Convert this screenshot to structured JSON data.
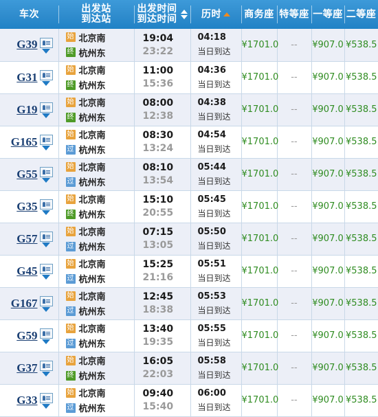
{
  "header": {
    "code_label": "车次",
    "station_label_top": "出发站",
    "station_label_bottom": "到达站",
    "time_label_top": "出发时间",
    "time_label_bottom": "到达时间",
    "duration_label": "历时",
    "business_label": "商务座",
    "premium_label": "特等座",
    "first_label": "一等座",
    "second_label": "二等座",
    "sort_active_column": "历时",
    "sort_direction": "asc",
    "bg_color": "#2f8ccd",
    "active_sort_color": "#f08a1e"
  },
  "legend": {
    "start_marker": "始",
    "end_marker": "终",
    "pass_marker": "过",
    "start_color": "#e8a33d",
    "end_color": "#4f9b28",
    "pass_color": "#5b9bd5"
  },
  "icons": {
    "detail_icon": "train-detail-icon",
    "expand_icon": "chevron-down-icon",
    "sort_up_icon": "sort-ascending-icon",
    "sort_down_icon": "sort-descending-icon"
  },
  "rows": [
    {
      "code": "G39",
      "from_marker": "始",
      "from_type": "start",
      "from_station": "北京南",
      "to_marker": "终",
      "to_type": "end",
      "to_station": "杭州东",
      "depart": "19:04",
      "arrive": "23:22",
      "duration": "04:18",
      "arrive_note": "当日到达",
      "business": "¥1701.0",
      "premium": "--",
      "first": "¥907.0",
      "second": "¥538.5"
    },
    {
      "code": "G31",
      "from_marker": "始",
      "from_type": "start",
      "from_station": "北京南",
      "to_marker": "终",
      "to_type": "end",
      "to_station": "杭州东",
      "depart": "11:00",
      "arrive": "15:36",
      "duration": "04:36",
      "arrive_note": "当日到达",
      "business": "¥1701.0",
      "premium": "--",
      "first": "¥907.0",
      "second": "¥538.5"
    },
    {
      "code": "G19",
      "from_marker": "始",
      "from_type": "start",
      "from_station": "北京南",
      "to_marker": "终",
      "to_type": "end",
      "to_station": "杭州东",
      "depart": "08:00",
      "arrive": "12:38",
      "duration": "04:38",
      "arrive_note": "当日到达",
      "business": "¥1701.0",
      "premium": "--",
      "first": "¥907.0",
      "second": "¥538.5"
    },
    {
      "code": "G165",
      "from_marker": "始",
      "from_type": "start",
      "from_station": "北京南",
      "to_marker": "过",
      "to_type": "pass",
      "to_station": "杭州东",
      "depart": "08:30",
      "arrive": "13:24",
      "duration": "04:54",
      "arrive_note": "当日到达",
      "business": "¥1701.0",
      "premium": "--",
      "first": "¥907.0",
      "second": "¥538.5"
    },
    {
      "code": "G55",
      "from_marker": "始",
      "from_type": "start",
      "from_station": "北京南",
      "to_marker": "过",
      "to_type": "pass",
      "to_station": "杭州东",
      "depart": "08:10",
      "arrive": "13:54",
      "duration": "05:44",
      "arrive_note": "当日到达",
      "business": "¥1701.0",
      "premium": "--",
      "first": "¥907.0",
      "second": "¥538.5"
    },
    {
      "code": "G35",
      "from_marker": "始",
      "from_type": "start",
      "from_station": "北京南",
      "to_marker": "终",
      "to_type": "end",
      "to_station": "杭州东",
      "depart": "15:10",
      "arrive": "20:55",
      "duration": "05:45",
      "arrive_note": "当日到达",
      "business": "¥1701.0",
      "premium": "--",
      "first": "¥907.0",
      "second": "¥538.5"
    },
    {
      "code": "G57",
      "from_marker": "始",
      "from_type": "start",
      "from_station": "北京南",
      "to_marker": "过",
      "to_type": "pass",
      "to_station": "杭州东",
      "depart": "07:15",
      "arrive": "13:05",
      "duration": "05:50",
      "arrive_note": "当日到达",
      "business": "¥1701.0",
      "premium": "--",
      "first": "¥907.0",
      "second": "¥538.5"
    },
    {
      "code": "G45",
      "from_marker": "始",
      "from_type": "start",
      "from_station": "北京南",
      "to_marker": "过",
      "to_type": "pass",
      "to_station": "杭州东",
      "depart": "15:25",
      "arrive": "21:16",
      "duration": "05:51",
      "arrive_note": "当日到达",
      "business": "¥1701.0",
      "premium": "--",
      "first": "¥907.0",
      "second": "¥538.5"
    },
    {
      "code": "G167",
      "from_marker": "始",
      "from_type": "start",
      "from_station": "北京南",
      "to_marker": "过",
      "to_type": "pass",
      "to_station": "杭州东",
      "depart": "12:45",
      "arrive": "18:38",
      "duration": "05:53",
      "arrive_note": "当日到达",
      "business": "¥1701.0",
      "premium": "--",
      "first": "¥907.0",
      "second": "¥538.5"
    },
    {
      "code": "G59",
      "from_marker": "始",
      "from_type": "start",
      "from_station": "北京南",
      "to_marker": "过",
      "to_type": "pass",
      "to_station": "杭州东",
      "depart": "13:40",
      "arrive": "19:35",
      "duration": "05:55",
      "arrive_note": "当日到达",
      "business": "¥1701.0",
      "premium": "--",
      "first": "¥907.0",
      "second": "¥538.5"
    },
    {
      "code": "G37",
      "from_marker": "始",
      "from_type": "start",
      "from_station": "北京南",
      "to_marker": "终",
      "to_type": "end",
      "to_station": "杭州东",
      "depart": "16:05",
      "arrive": "22:03",
      "duration": "05:58",
      "arrive_note": "当日到达",
      "business": "¥1701.0",
      "premium": "--",
      "first": "¥907.0",
      "second": "¥538.5"
    },
    {
      "code": "G33",
      "from_marker": "始",
      "from_type": "start",
      "from_station": "北京南",
      "to_marker": "过",
      "to_type": "pass",
      "to_station": "杭州东",
      "depart": "09:40",
      "arrive": "15:40",
      "duration": "06:00",
      "arrive_note": "当日到达",
      "business": "¥1701.0",
      "premium": "--",
      "first": "¥907.0",
      "second": "¥538.5"
    }
  ]
}
